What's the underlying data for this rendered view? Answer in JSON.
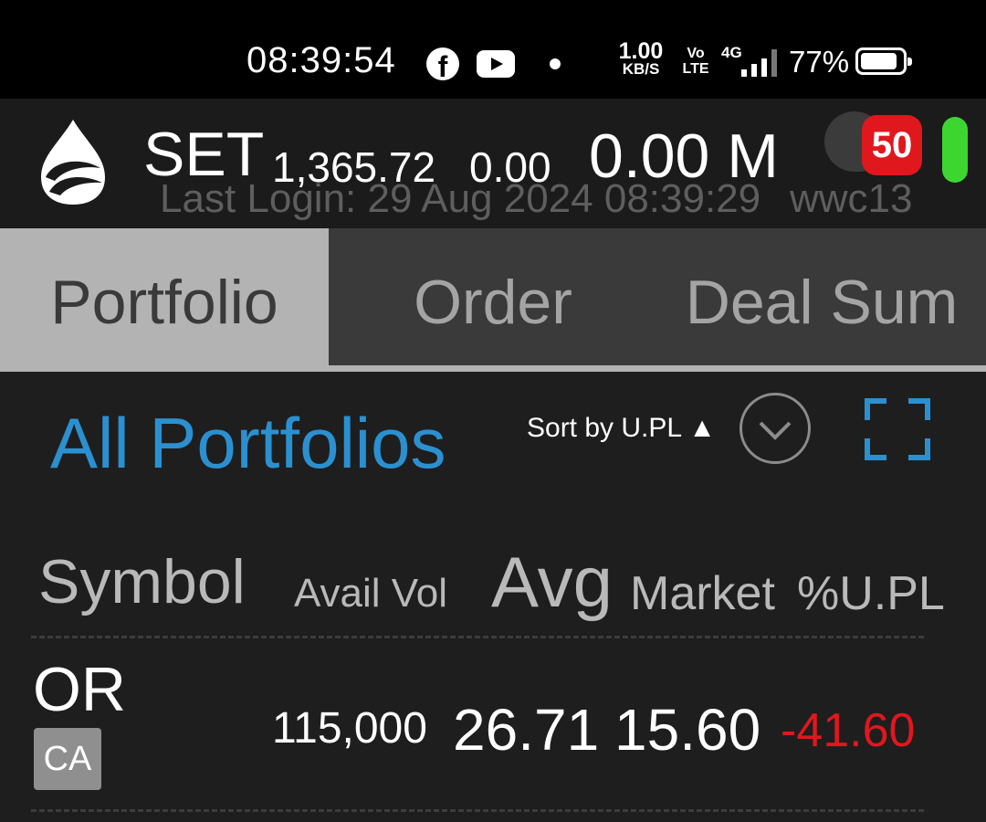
{
  "status_bar": {
    "time": "08:39:54",
    "icons": [
      "facebook-icon",
      "youtube-icon",
      "notification-dot-icon"
    ],
    "net_speed_value": "1.00",
    "net_speed_unit": "KB/S",
    "volte_top": "Vo",
    "volte_bottom": "LTE",
    "network": "4G",
    "battery_pct": "77%",
    "battery_level": 0.77
  },
  "header": {
    "market": "SET",
    "index_value": "1,365.72",
    "index_change": "0.00",
    "volume": "0.00 M",
    "last_login": "Last Login: 29 Aug 2024 08:39:29",
    "user_id": "wwc13",
    "notification_count": "50",
    "colors": {
      "badge": "#e1171e",
      "status": "#3dd631"
    }
  },
  "tabs": [
    {
      "label": "Portfolio",
      "active": true
    },
    {
      "label": "Order",
      "active": false
    },
    {
      "label": "Deal Sum",
      "active": false
    }
  ],
  "portfolio": {
    "title": "All Portfolios",
    "sort_label": "Sort by U.PL ▲",
    "accent_color": "#2b90d0"
  },
  "columns": {
    "symbol": "Symbol",
    "avail_vol": "Avail Vol",
    "avg": "Avg",
    "market": "Market",
    "upl_pct": "%U.PL"
  },
  "rows": [
    {
      "symbol": "OR",
      "tag": "CA",
      "avail_vol": "115,000",
      "avg": "26.71",
      "market": "15.60",
      "upl_pct": "-41.60",
      "upl_color": "#e1171e"
    }
  ]
}
